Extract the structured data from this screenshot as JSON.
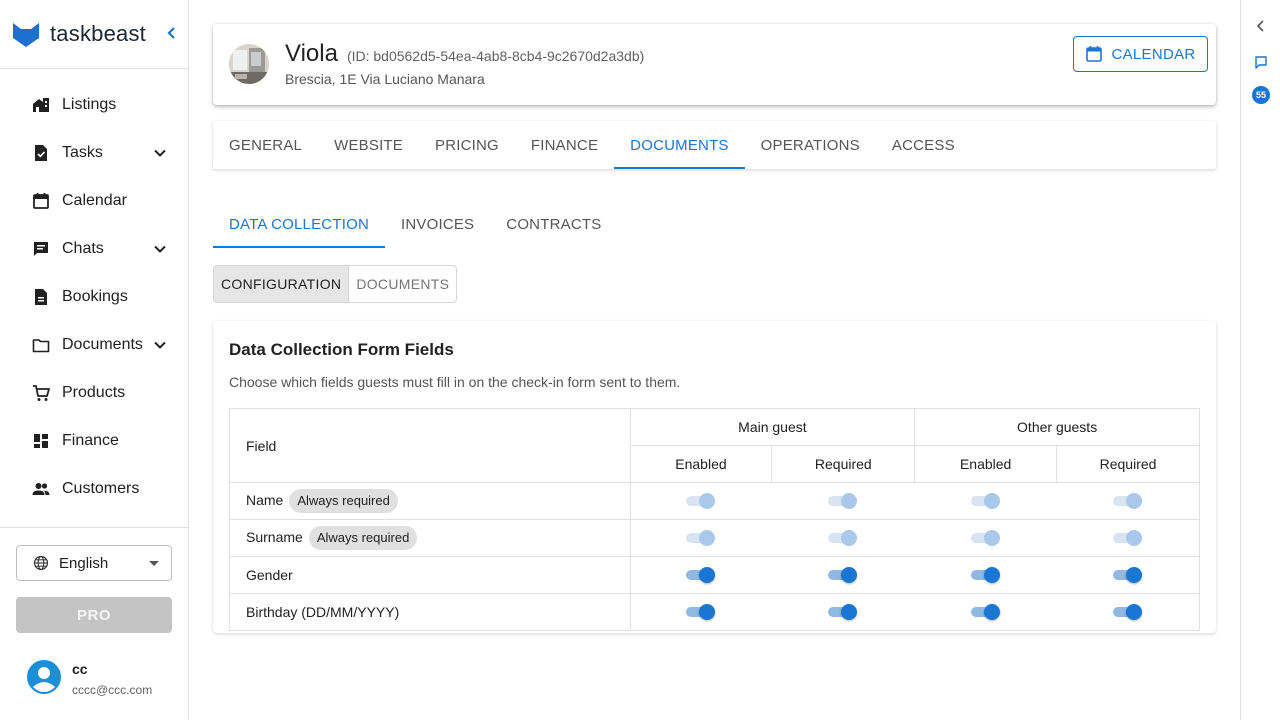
{
  "brand": {
    "name": "taskbeast"
  },
  "sidebar": {
    "items": [
      {
        "label": "Listings",
        "icon": "home-work-icon",
        "expandable": false
      },
      {
        "label": "Tasks",
        "icon": "task-icon",
        "expandable": true
      },
      {
        "label": "Calendar",
        "icon": "calendar-icon",
        "expandable": false
      },
      {
        "label": "Chats",
        "icon": "chat-icon",
        "expandable": true
      },
      {
        "label": "Bookings",
        "icon": "description-icon",
        "expandable": false
      },
      {
        "label": "Documents",
        "icon": "folder-icon",
        "expandable": true
      },
      {
        "label": "Products",
        "icon": "cart-icon",
        "expandable": false
      },
      {
        "label": "Finance",
        "icon": "dashboard-icon",
        "expandable": false
      },
      {
        "label": "Customers",
        "icon": "people-icon",
        "expandable": false
      }
    ],
    "language": "English",
    "pro_label": "PRO",
    "user": {
      "name": "cc",
      "email": "cccc@ccc.com"
    }
  },
  "rail": {
    "badge_count": "55"
  },
  "property": {
    "name": "Viola",
    "id_text": "(ID: bd0562d5-54ea-4ab8-8cb4-9c2670d2a3db)",
    "address": "Brescia, 1E Via Luciano Manara",
    "calendar_label": "CALENDAR"
  },
  "tabs": [
    {
      "label": "GENERAL",
      "active": false
    },
    {
      "label": "WEBSITE",
      "active": false
    },
    {
      "label": "PRICING",
      "active": false
    },
    {
      "label": "FINANCE",
      "active": false
    },
    {
      "label": "DOCUMENTS",
      "active": true
    },
    {
      "label": "OPERATIONS",
      "active": false
    },
    {
      "label": "ACCESS",
      "active": false
    }
  ],
  "subtabs": [
    {
      "label": "DATA COLLECTION",
      "active": true
    },
    {
      "label": "INVOICES",
      "active": false
    },
    {
      "label": "CONTRACTS",
      "active": false
    }
  ],
  "toggle": {
    "configuration": "CONFIGURATION",
    "documents": "DOCUMENTS"
  },
  "form": {
    "title": "Data Collection Form Fields",
    "description": "Choose which fields guests must fill in on the check-in form sent to them.",
    "headers": {
      "field": "Field",
      "main_guest": "Main guest",
      "other_guests": "Other guests",
      "enabled": "Enabled",
      "required": "Required"
    },
    "rows": [
      {
        "field": "Name",
        "chip": "Always required",
        "values": [
          true,
          true,
          true,
          true
        ],
        "disabled": true
      },
      {
        "field": "Surname",
        "chip": "Always required",
        "values": [
          true,
          true,
          true,
          true
        ],
        "disabled": true
      },
      {
        "field": "Gender",
        "chip": "",
        "values": [
          true,
          true,
          true,
          true
        ],
        "disabled": false
      },
      {
        "field": "Birthday (DD/MM/YYYY)",
        "chip": "",
        "values": [
          true,
          true,
          true,
          true
        ],
        "disabled": false
      }
    ]
  },
  "colors": {
    "accent": "#1976d2",
    "logo": "#1565c0",
    "avatar": "#1a8fd6"
  }
}
